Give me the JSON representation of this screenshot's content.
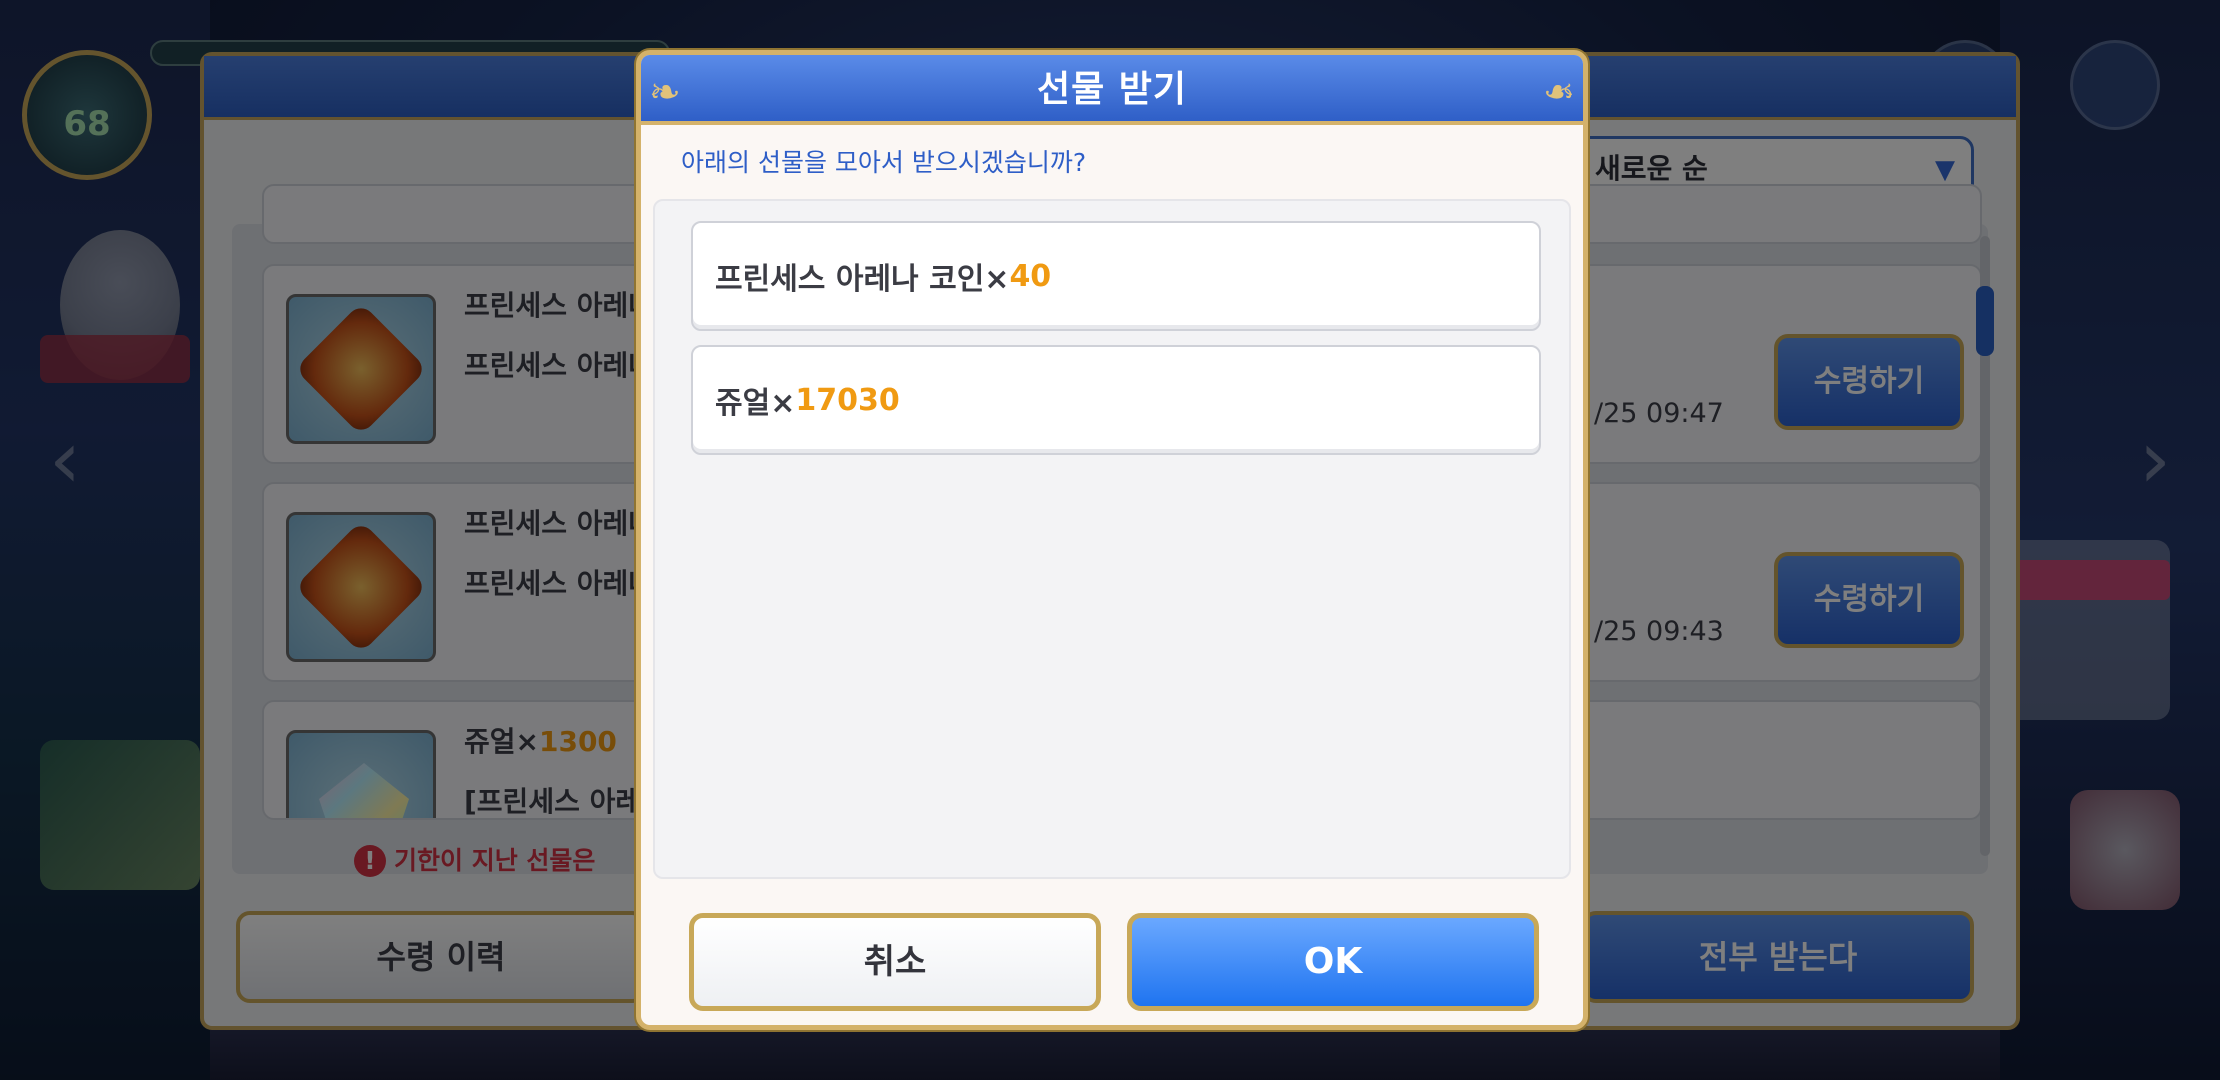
{
  "background": {
    "player_level": "68",
    "sort_label": "새로운 순",
    "expire_notice": "기한이 지난 선물은 ",
    "history_button": "수령 이력",
    "receive_all_button": "전부 받는다",
    "gift_rows": [
      {
        "title": "프린세스 아레나",
        "subtitle": "프린세스 아레나",
        "date": "/25 09:47",
        "button": "수령하기",
        "icon": "arena-coin-icon"
      },
      {
        "title": "프린세스 아레나",
        "subtitle": "프린세스 아레나",
        "date": "/25 09:43",
        "button": "수령하기",
        "icon": "arena-coin-icon"
      },
      {
        "title_prefix": "쥬얼×",
        "title_amount": "1300",
        "subtitle": "[프린세스 아레나",
        "icon": "jewel-icon"
      }
    ]
  },
  "dialog": {
    "title": "선물 받기",
    "question": "아래의 선물을 모아서 받으시겠습니까?",
    "items": [
      {
        "name": "프린세스 아레나 코인×",
        "amount": "40"
      },
      {
        "name": "쥬얼×",
        "amount": "17030"
      }
    ],
    "cancel_label": "취소",
    "ok_label": "OK"
  },
  "colors": {
    "accent_blue": "#2f5fc7",
    "amount_orange": "#f09a12",
    "gold_border": "#d4b26a",
    "warning_red": "#d23344"
  }
}
